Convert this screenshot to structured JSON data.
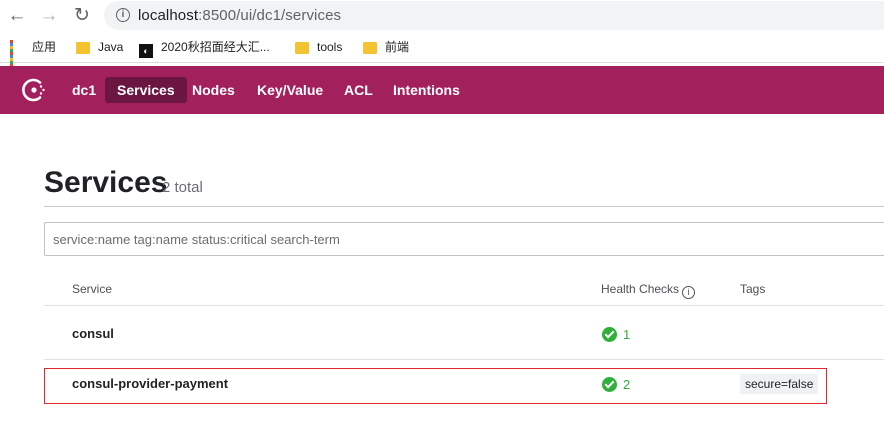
{
  "browser": {
    "url_host": "localhost",
    "url_path": ":8500/ui/dc1/services",
    "bookmarks": [
      {
        "label": "应用",
        "icon": "apps-grid-icon"
      },
      {
        "label": "Java",
        "icon": "folder-icon"
      },
      {
        "label": "2020秋招面经大汇...",
        "icon": "site-favicon-icon"
      },
      {
        "label": "tools",
        "icon": "folder-icon"
      },
      {
        "label": "前端",
        "icon": "folder-icon"
      }
    ]
  },
  "nav": {
    "datacenter": "dc1",
    "items": [
      "Services",
      "Nodes",
      "Key/Value",
      "ACL",
      "Intentions"
    ],
    "active": "Services",
    "brand_color": "#a2215c"
  },
  "page": {
    "title": "Services",
    "count": "2 total"
  },
  "search": {
    "placeholder": "service:name tag:name status:critical search-term",
    "value": ""
  },
  "table": {
    "headers": {
      "service": "Service",
      "health": "Health Checks",
      "tags": "Tags"
    },
    "rows": [
      {
        "name": "consul",
        "health_passing": "1",
        "tags": []
      },
      {
        "name": "consul-provider-payment",
        "health_passing": "2",
        "tags": [
          "secure=false"
        ]
      }
    ]
  }
}
